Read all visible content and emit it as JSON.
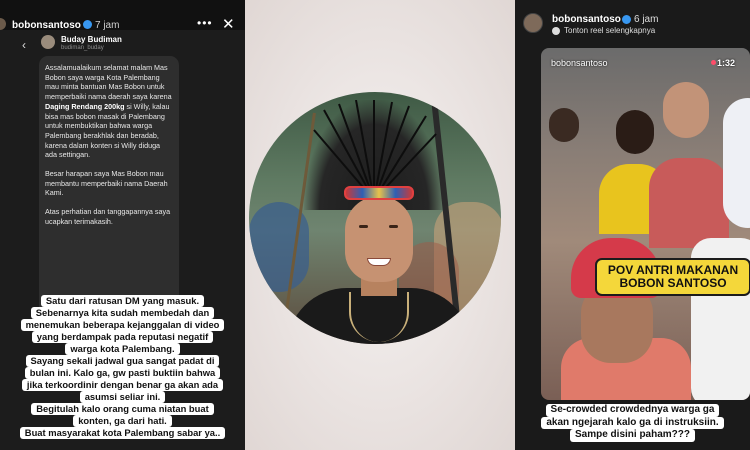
{
  "left_story": {
    "username": "bobonsantoso",
    "time": "7 jam",
    "more_icon": "more-horizontal-icon",
    "close_icon": "close-icon",
    "dm": {
      "back_icon": "chevron-left-icon",
      "sender_name": "Buday Budiman",
      "sender_handle": "budiman_buday",
      "message_p1_before": "Assalamualaikum selamat malam Mas Bobon saya warga Kota Palembang mau minta bantuan Mas Bobon untuk memperbaiki nama daerah saya karena ",
      "message_p1_bold": "Daging Rendang 200kg",
      "message_p1_after": " si Willy, kalau bisa mas bobon masak di Palembang untuk membuktikan bahwa warga Palembang berakhlak dan beradab, karena dalam konten si Willy diduga ada settingan.",
      "message_p2": "Besar harapan saya Mas Bobon mau membantu memperbaiki nama Daerah Kami.",
      "message_p3": "Atas perhatian dan tanggapannya saya ucapkan terimakasih."
    },
    "caption_lines": [
      "Satu dari ratusan DM yang masuk.",
      "Sebenarnya kita sudah membedah dan",
      "menemukan beberapa kejanggalan di video",
      "yang berdampak pada reputasi negatif",
      "warga kota Palembang.",
      "Sayang sekali jadwal gua sangat padat di",
      "bulan ini. Kalo ga, gw pasti buktiin bahwa",
      "jika terkoordinir dengan benar ga akan ada",
      "asumsi seliar ini.",
      "Begitulah kalo orang cuma niatan buat",
      "konten, ga dari hati.",
      "Buat masyarakat kota Palembang sabar ya.."
    ]
  },
  "right_story": {
    "username": "bobonsantoso",
    "time": "6 jam",
    "reel_link": "Tonton reel selengkapnya",
    "reel_handle": "bobonsantoso",
    "reel_duration": "1:32",
    "overlay_title": "POV ANTRI MAKANAN BOBON SANTOSO",
    "caption_lines": [
      "Se-crowded crowdednya warga ga",
      "akan ngejarah kalo ga di instruksiin.",
      "Sampe disini paham???"
    ]
  },
  "colors": {
    "verified_badge": "#3897f0",
    "overlay_yellow": "#f4d73a"
  }
}
